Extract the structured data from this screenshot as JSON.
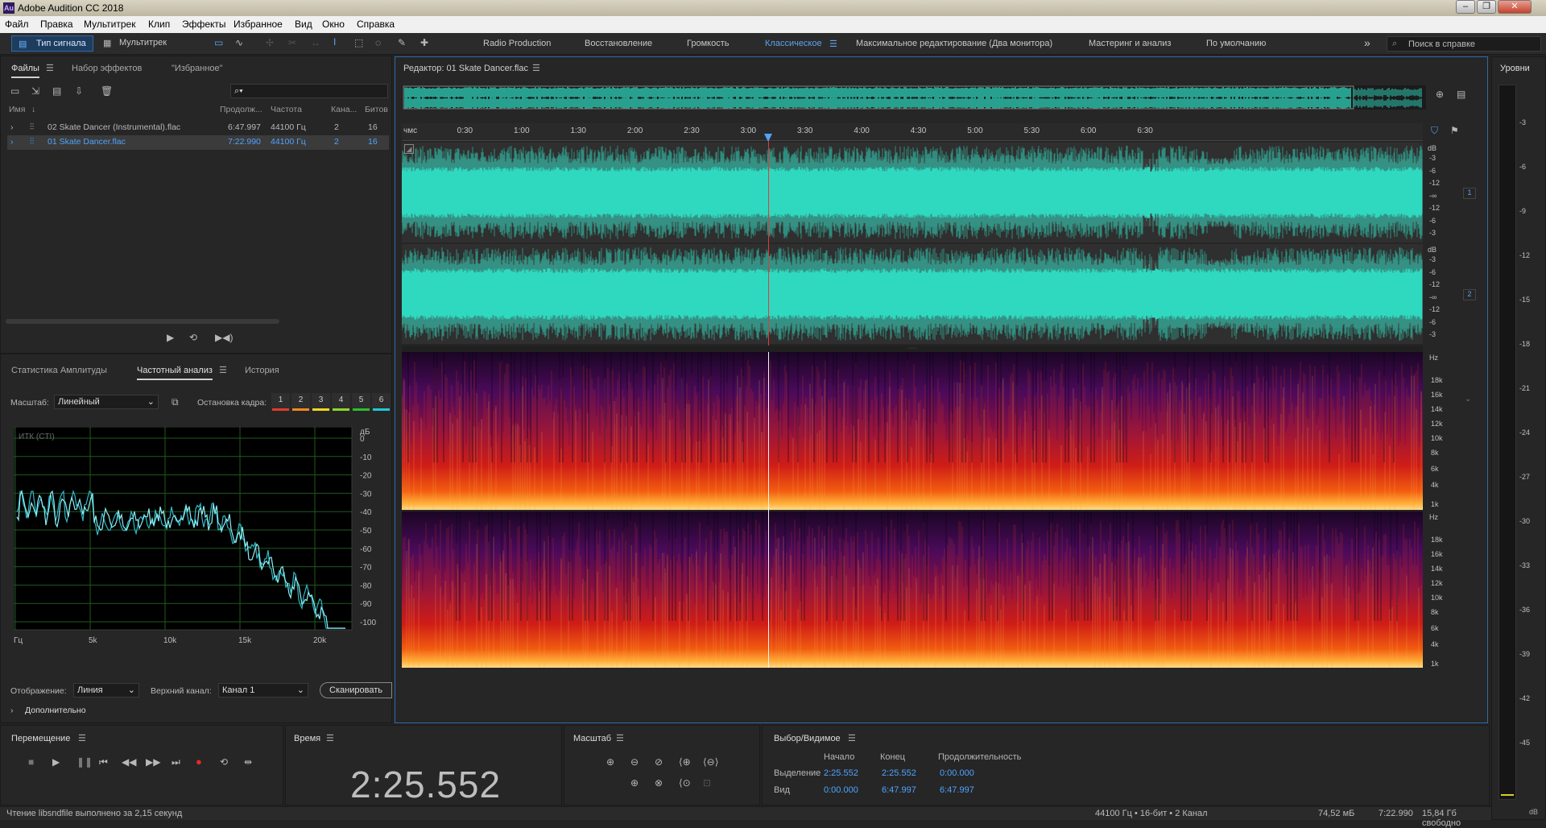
{
  "app": {
    "title": "Adobe Audition CC 2018",
    "icon_text": "Au"
  },
  "menu": [
    "Файл",
    "Правка",
    "Мультитрек",
    "Клип",
    "Эффекты",
    "Избранное",
    "Вид",
    "Окно",
    "Справка"
  ],
  "toolbar": {
    "waveform_label": "Тип сигнала",
    "multitrack_label": "Мультитрек",
    "workspaces": [
      "Radio Production",
      "Восстановление",
      "Громкость",
      "Классическое",
      "Максимальное редактирование (Два монитора)",
      "Мастеринг и анализ",
      "По умолчанию"
    ],
    "active_workspace": "Классическое",
    "search_placeholder": "Поиск в справке"
  },
  "files_panel": {
    "tabs": [
      "Файлы",
      "Набор эффектов",
      "\"Избранное\""
    ],
    "columns": [
      "Имя",
      "Продолж...",
      "Частота",
      "Кана...",
      "Битов"
    ],
    "rows": [
      {
        "name": "02 Skate Dancer (Instrumental).flac",
        "duration": "6:47.997",
        "rate": "44100 Гц",
        "channels": "2",
        "bits": "16",
        "selected": false
      },
      {
        "name": "01 Skate Dancer.flac",
        "duration": "7:22.990",
        "rate": "44100 Гц",
        "channels": "2",
        "bits": "16",
        "selected": true
      }
    ]
  },
  "analysis_panel": {
    "tabs": [
      "Статистика Амплитуды",
      "Частотный анализ",
      "История"
    ],
    "scale_label": "Масштаб:",
    "scale_value": "Линейный",
    "freeze_label": "Остановка кадра:",
    "freeze_buttons": [
      "1",
      "2",
      "3",
      "4",
      "5",
      "6"
    ],
    "freeze_colors": [
      "#e23a2a",
      "#f08a18",
      "#f0d820",
      "#8dd828",
      "#2cbf2c",
      "#20c8d8"
    ],
    "plot_title": "ИТК (CTI)",
    "db_unit": "дБ",
    "db_labels": [
      "0",
      "-10",
      "-20",
      "-30",
      "-40",
      "-50",
      "-60",
      "-70",
      "-80",
      "-90",
      "-100"
    ],
    "hz_labels": [
      "Гц",
      "5k",
      "10k",
      "15k",
      "20k"
    ],
    "display_label": "Отображение:",
    "display_value": "Линия",
    "channel_label": "Верхний канал:",
    "channel_value": "Канал 1",
    "scan_button": "Сканировать",
    "advanced": "Дополнительно"
  },
  "editor": {
    "title": "Редактор: 01 Skate Dancer.flac",
    "ruler_unit": "чмс",
    "ruler": [
      "0:30",
      "1:00",
      "1:30",
      "2:00",
      "2:30",
      "3:00",
      "3:30",
      "4:00",
      "4:30",
      "5:00",
      "5:30",
      "6:00",
      "6:30"
    ],
    "db_unit": "dB",
    "db_labels": [
      "-3",
      "-6",
      "-12",
      "-∞",
      "-12",
      "-6",
      "-3"
    ],
    "channels": [
      "1",
      "2"
    ],
    "hz_unit": "Hz",
    "spec_labels": [
      "18k",
      "16k",
      "14k",
      "12k",
      "10k",
      "8k",
      "6k",
      "4k",
      "1k"
    ],
    "playhead_time": "2:25.552"
  },
  "levels": {
    "title": "Уровни",
    "labels": [
      "-3",
      "-6",
      "-9",
      "-12",
      "-15",
      "-18",
      "-21",
      "-24",
      "-27",
      "-30",
      "-33",
      "-36",
      "-39",
      "-42",
      "-45"
    ],
    "unit": "dB"
  },
  "transport": {
    "title": "Перемещение"
  },
  "time_panel": {
    "title": "Время",
    "value": "2:25.552"
  },
  "zoom_panel": {
    "title": "Масштаб"
  },
  "selection_panel": {
    "title": "Выбор/Видимое",
    "col_start": "Начало",
    "col_end": "Конец",
    "col_duration": "Продолжительность",
    "rows": [
      {
        "label": "Выделение",
        "start": "2:25.552",
        "end": "2:25.552",
        "duration": "0:00.000"
      },
      {
        "label": "Вид",
        "start": "0:00.000",
        "end": "6:47.997",
        "duration": "6:47.997"
      }
    ]
  },
  "status": {
    "message": "Чтение libsndfile выполнено за 2,15 секунд",
    "format": "44100 Гц • 16-бит • 2 Канал",
    "size": "74,52 мБ",
    "duration": "7:22.990",
    "free": "15,84 Гб свободно"
  },
  "colors": {
    "waveform": "#2fd9c0",
    "accent": "#4ea4ff",
    "playhead": "#e23a3a",
    "spectrum_line": "#7fe8f0"
  }
}
